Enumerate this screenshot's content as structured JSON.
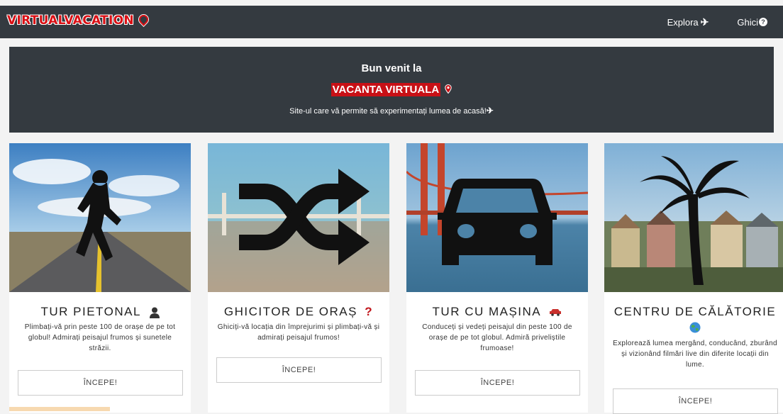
{
  "navbar": {
    "brand": "VIRTUALVACATION",
    "links": [
      {
        "label": "Explora",
        "icon": "plane-icon"
      },
      {
        "label": "Ghici",
        "icon": "question-circle-icon"
      }
    ]
  },
  "hero": {
    "title": "Bun venit la",
    "brand": "VACANTA VIRTUALA",
    "subtitle": "Site-ul care vă permite să experimentați lumea de acasă!"
  },
  "cards": [
    {
      "title": "TUR PIETONAL",
      "icon": "user-icon",
      "image_icon": "walking-person-icon",
      "description": "Plimbați-vă prin peste 100 de orașe de pe tot globul! Admirați peisajul frumos și sunetele străzii.",
      "button": "ÎNCEPE!"
    },
    {
      "title": "GHICITOR DE ORAȘ",
      "icon": "question-mark-icon",
      "image_icon": "shuffle-icon",
      "description": "Ghiciți-vă locația din împrejurimi și plimbați-vă și admirați peisajul frumos!",
      "button": "ÎNCEPE!"
    },
    {
      "title": "TUR CU MAȘINA",
      "icon": "car-icon",
      "image_icon": "car-front-icon",
      "description": "Conduceți și vedeți peisajul din peste 100 de orașe de pe tot globul. Admiră priveliștile frumoase!",
      "button": "ÎNCEPE!"
    },
    {
      "title": "CENTRU DE CĂLĂTORIE",
      "icon": "globe-icon",
      "image_icon": "palm-tree-icon",
      "description": "Explorează lumea mergând, conducând, zburând și vizionând filmări live din diferite locații din lume.",
      "button": "ÎNCEPE!"
    }
  ],
  "colors": {
    "navbar_bg": "#343a40",
    "brand_red": "#d90f14",
    "page_bg": "#f3f3f3"
  }
}
